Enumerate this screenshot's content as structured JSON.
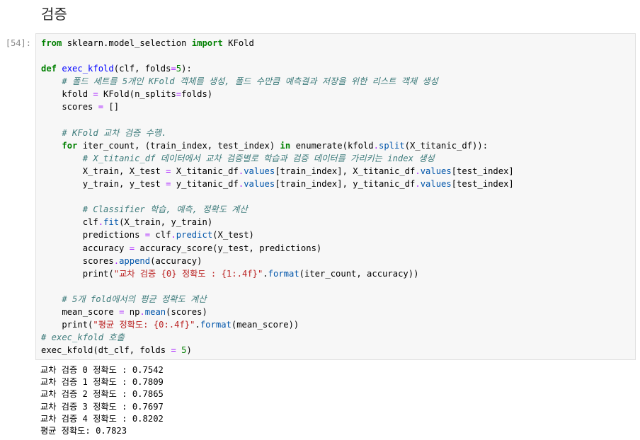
{
  "heading": "검증",
  "cell": {
    "prompt": "[54]:",
    "code_lines": [
      [
        {
          "t": "from",
          "c": "kw"
        },
        {
          "t": " sklearn.model_selection "
        },
        {
          "t": "import",
          "c": "kw"
        },
        {
          "t": " KFold"
        }
      ],
      [],
      [
        {
          "t": "def",
          "c": "kw"
        },
        {
          "t": " "
        },
        {
          "t": "exec_kfold",
          "c": "fn"
        },
        {
          "t": "(clf, folds"
        },
        {
          "t": "=",
          "c": "op"
        },
        {
          "t": "5",
          "c": "nm"
        },
        {
          "t": "):"
        }
      ],
      [
        {
          "t": "    "
        },
        {
          "t": "# 폴드 세트를 5개인 KFold 객체를 생성, 폴드 수만큼 예측결과 저장을 위한 리스트 객체 생성",
          "c": "cm"
        }
      ],
      [
        {
          "t": "    kfold "
        },
        {
          "t": "=",
          "c": "op"
        },
        {
          "t": " KFold(n_splits"
        },
        {
          "t": "=",
          "c": "op"
        },
        {
          "t": "folds)"
        }
      ],
      [
        {
          "t": "    scores "
        },
        {
          "t": "=",
          "c": "op"
        },
        {
          "t": " []"
        }
      ],
      [],
      [
        {
          "t": "    "
        },
        {
          "t": "# KFold 교차 검증 수행.",
          "c": "cm"
        }
      ],
      [
        {
          "t": "    "
        },
        {
          "t": "for",
          "c": "kw"
        },
        {
          "t": " iter_count, (train_index, test_index) "
        },
        {
          "t": "in",
          "c": "kw"
        },
        {
          "t": " enumerate(kfold"
        },
        {
          "t": ".",
          "c": "op"
        },
        {
          "t": "split",
          "c": "at"
        },
        {
          "t": "(X_titanic_df)):"
        }
      ],
      [
        {
          "t": "        "
        },
        {
          "t": "# X_titanic_df 데이터에서 교차 검증별로 학습과 검증 데이터를 가리키는 index 생성",
          "c": "cm"
        }
      ],
      [
        {
          "t": "        X_train, X_test "
        },
        {
          "t": "=",
          "c": "op"
        },
        {
          "t": " X_titanic_df"
        },
        {
          "t": ".",
          "c": "op"
        },
        {
          "t": "values",
          "c": "at"
        },
        {
          "t": "[train_index], X_titanic_df"
        },
        {
          "t": ".",
          "c": "op"
        },
        {
          "t": "values",
          "c": "at"
        },
        {
          "t": "[test_index]"
        }
      ],
      [
        {
          "t": "        y_train, y_test "
        },
        {
          "t": "=",
          "c": "op"
        },
        {
          "t": " y_titanic_df"
        },
        {
          "t": ".",
          "c": "op"
        },
        {
          "t": "values",
          "c": "at"
        },
        {
          "t": "[train_index], y_titanic_df"
        },
        {
          "t": ".",
          "c": "op"
        },
        {
          "t": "values",
          "c": "at"
        },
        {
          "t": "[test_index]"
        }
      ],
      [],
      [
        {
          "t": "        "
        },
        {
          "t": "# Classifier 학습, 예측, 정확도 계산",
          "c": "cm"
        }
      ],
      [
        {
          "t": "        clf"
        },
        {
          "t": ".",
          "c": "op"
        },
        {
          "t": "fit",
          "c": "at"
        },
        {
          "t": "(X_train, y_train)"
        }
      ],
      [
        {
          "t": "        predictions "
        },
        {
          "t": "=",
          "c": "op"
        },
        {
          "t": " clf"
        },
        {
          "t": ".",
          "c": "op"
        },
        {
          "t": "predict",
          "c": "at"
        },
        {
          "t": "(X_test)"
        }
      ],
      [
        {
          "t": "        accuracy "
        },
        {
          "t": "=",
          "c": "op"
        },
        {
          "t": " accuracy_score(y_test, predictions)"
        }
      ],
      [
        {
          "t": "        scores"
        },
        {
          "t": ".",
          "c": "op"
        },
        {
          "t": "append",
          "c": "at"
        },
        {
          "t": "(accuracy)"
        }
      ],
      [
        {
          "t": "        print("
        },
        {
          "t": "\"교차 검증 {0} 정확도 : {1:.4f}\"",
          "c": "st"
        },
        {
          "t": "."
        },
        {
          "t": "format",
          "c": "at"
        },
        {
          "t": "(iter_count, accuracy))"
        }
      ],
      [],
      [
        {
          "t": "    "
        },
        {
          "t": "# 5개 fold에서의 평균 정확도 계산",
          "c": "cm"
        }
      ],
      [
        {
          "t": "    mean_score "
        },
        {
          "t": "=",
          "c": "op"
        },
        {
          "t": " np"
        },
        {
          "t": ".",
          "c": "op"
        },
        {
          "t": "mean",
          "c": "at"
        },
        {
          "t": "(scores)"
        }
      ],
      [
        {
          "t": "    print("
        },
        {
          "t": "\"평균 정확도: {0:.4f}\"",
          "c": "st"
        },
        {
          "t": "."
        },
        {
          "t": "format",
          "c": "at"
        },
        {
          "t": "(mean_score))"
        }
      ],
      [
        {
          "t": "# exec_kfold 호출",
          "c": "cm"
        }
      ],
      [
        {
          "t": "exec_kfold(dt_clf, folds "
        },
        {
          "t": "=",
          "c": "op"
        },
        {
          "t": " "
        },
        {
          "t": "5",
          "c": "nm"
        },
        {
          "t": ")"
        }
      ]
    ],
    "output_lines": [
      "교차 검증 0 정확도 : 0.7542",
      "교차 검증 1 정확도 : 0.7809",
      "교차 검증 2 정확도 : 0.7865",
      "교차 검증 3 정확도 : 0.7697",
      "교차 검증 4 정확도 : 0.8202",
      "평균 정확도: 0.7823"
    ]
  }
}
